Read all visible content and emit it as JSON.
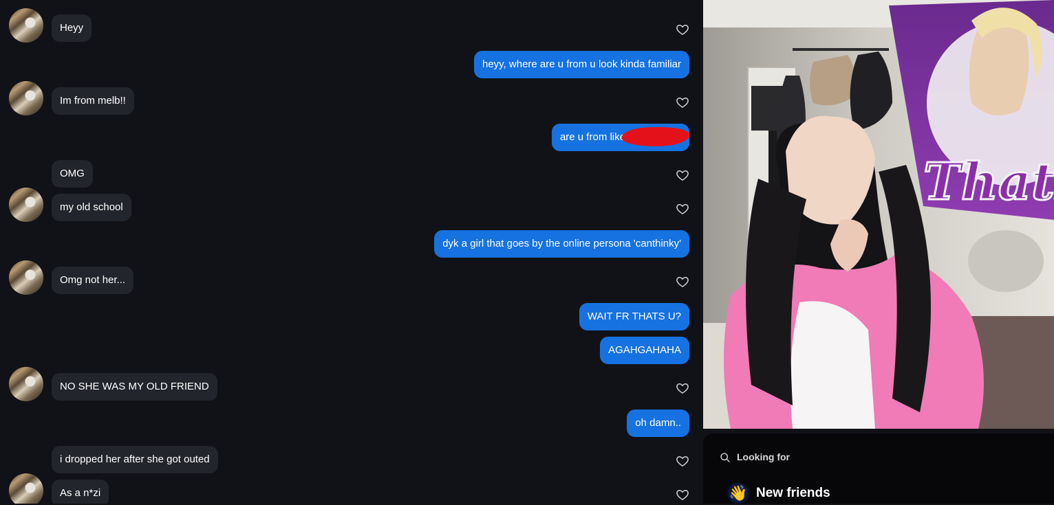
{
  "messages": [
    {
      "side": "in",
      "text": "Heyy"
    },
    {
      "side": "out",
      "text": "heyy, where are u from u look kinda familiar"
    },
    {
      "side": "in",
      "text": "Im from melb!!"
    },
    {
      "side": "out",
      "text": "are u from like"
    },
    {
      "side": "in",
      "text": "OMG"
    },
    {
      "side": "in",
      "text": "my old school"
    },
    {
      "side": "out",
      "text": "dyk a girl that goes by the online persona 'canthinky'"
    },
    {
      "side": "in",
      "text": "Omg not her..."
    },
    {
      "side": "out",
      "text": "WAIT FR THATS U?"
    },
    {
      "side": "out",
      "text": "AGAHGAHAHA"
    },
    {
      "side": "in",
      "text": "NO SHE WAS MY OLD FRIEND"
    },
    {
      "side": "out",
      "text": "oh damn.."
    },
    {
      "side": "in",
      "text": "i dropped her after she got outed"
    },
    {
      "side": "in",
      "text": "As a n*zi"
    }
  ],
  "sheet": {
    "search_label": "Looking for",
    "option_emoji": "👋",
    "option_label": "New friends"
  },
  "photo": {
    "poster_text": "Thats"
  },
  "colors": {
    "background": "#111217",
    "incoming_bubble": "#23252c",
    "outgoing_bubble": "#1672e0"
  }
}
